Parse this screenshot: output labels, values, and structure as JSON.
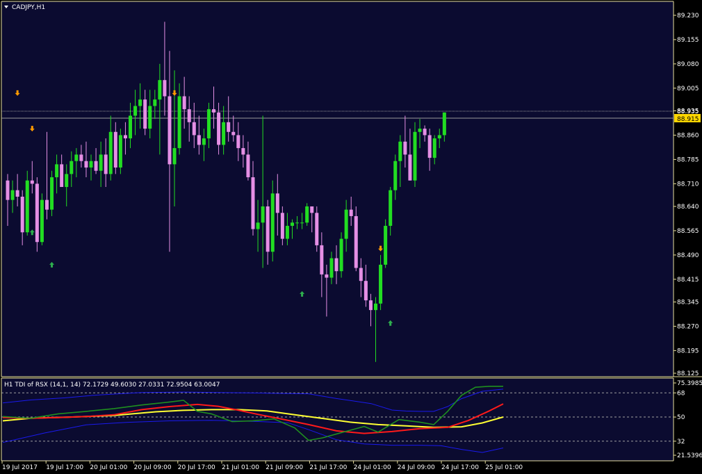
{
  "colors": {
    "background": "#000000",
    "plot_background": "#0b0b30",
    "frame": "#e8e0a0",
    "bull_candle": "#22dd22",
    "bear_candle": "#e58fe5",
    "price_label_bg": "#ffd700",
    "up_arrow": "#2eaf4e",
    "down_arrow": "#ff9a00",
    "tdi_green": "#1f8f1f",
    "tdi_red": "#ff1a1a",
    "tdi_yellow": "#ffff33",
    "tdi_blue": "#1a1aee",
    "level_line": "#a0a0a0"
  },
  "main_panel": {
    "title": "CADJPY,H1",
    "title_icon": "triangle-down-icon",
    "price_labels": [
      "89.230",
      "89.155",
      "89.080",
      "89.005",
      "88.935",
      "88.860",
      "88.785",
      "88.710",
      "88.640",
      "88.565",
      "88.490",
      "88.415",
      "88.345",
      "88.270",
      "88.195",
      "88.125"
    ],
    "current_price_label": "88.915",
    "ask_price_label": "88.935"
  },
  "indicator_panel": {
    "title": "H1 TDI of RSX  (14,1, 14) 72.1729 49.6030 27.0331 72.9504 63.0047",
    "labels": [
      "75.3985",
      "68",
      "50",
      "32",
      "21.5396"
    ],
    "levels": [
      68,
      50,
      32
    ]
  },
  "time_axis": {
    "labels": [
      "19 Jul 2017",
      "19 Jul 17:00",
      "20 Jul 01:00",
      "20 Jul 09:00",
      "20 Jul 17:00",
      "21 Jul 01:00",
      "21 Jul 09:00",
      "21 Jul 17:00",
      "24 Jul 01:00",
      "24 Jul 09:00",
      "24 Jul 17:00",
      "25 Jul 01:00"
    ]
  },
  "chart_data": {
    "type": "candlestick",
    "symbol": "CADJPY",
    "timeframe": "H1",
    "ylim": [
      88.125,
      89.23
    ],
    "candles": [
      {
        "o": 88.72,
        "h": 88.74,
        "l": 88.58,
        "c": 88.66
      },
      {
        "o": 88.66,
        "h": 88.72,
        "l": 88.62,
        "c": 88.69
      },
      {
        "o": 88.69,
        "h": 88.74,
        "l": 88.64,
        "c": 88.67
      },
      {
        "o": 88.67,
        "h": 88.69,
        "l": 88.52,
        "c": 88.56
      },
      {
        "o": 88.56,
        "h": 88.75,
        "l": 88.55,
        "c": 88.72
      },
      {
        "o": 88.72,
        "h": 88.78,
        "l": 88.68,
        "c": 88.71
      },
      {
        "o": 88.71,
        "h": 88.73,
        "l": 88.5,
        "c": 88.53
      },
      {
        "o": 88.53,
        "h": 88.68,
        "l": 88.52,
        "c": 88.66
      },
      {
        "o": 88.66,
        "h": 88.87,
        "l": 88.6,
        "c": 88.63
      },
      {
        "o": 88.63,
        "h": 88.75,
        "l": 88.61,
        "c": 88.73
      },
      {
        "o": 88.73,
        "h": 88.8,
        "l": 88.68,
        "c": 88.77
      },
      {
        "o": 88.77,
        "h": 88.8,
        "l": 88.72,
        "c": 88.7
      },
      {
        "o": 88.7,
        "h": 88.77,
        "l": 88.64,
        "c": 88.74
      },
      {
        "o": 88.74,
        "h": 88.81,
        "l": 88.7,
        "c": 88.78
      },
      {
        "o": 88.78,
        "h": 88.82,
        "l": 88.73,
        "c": 88.8
      },
      {
        "o": 88.8,
        "h": 88.83,
        "l": 88.76,
        "c": 88.78
      },
      {
        "o": 88.78,
        "h": 88.84,
        "l": 88.73,
        "c": 88.76
      },
      {
        "o": 88.76,
        "h": 88.8,
        "l": 88.72,
        "c": 88.78
      },
      {
        "o": 88.78,
        "h": 88.82,
        "l": 88.74,
        "c": 88.75
      },
      {
        "o": 88.75,
        "h": 88.84,
        "l": 88.7,
        "c": 88.8
      },
      {
        "o": 88.8,
        "h": 88.85,
        "l": 88.7,
        "c": 88.74
      },
      {
        "o": 88.74,
        "h": 88.92,
        "l": 88.72,
        "c": 88.87
      },
      {
        "o": 88.87,
        "h": 88.9,
        "l": 88.74,
        "c": 88.76
      },
      {
        "o": 88.76,
        "h": 88.88,
        "l": 88.74,
        "c": 88.86
      },
      {
        "o": 88.86,
        "h": 88.9,
        "l": 88.8,
        "c": 88.85
      },
      {
        "o": 88.85,
        "h": 88.96,
        "l": 88.82,
        "c": 88.92
      },
      {
        "o": 88.92,
        "h": 89.0,
        "l": 88.86,
        "c": 88.95
      },
      {
        "o": 88.95,
        "h": 89.02,
        "l": 88.88,
        "c": 88.97
      },
      {
        "o": 88.97,
        "h": 89.0,
        "l": 88.86,
        "c": 88.88
      },
      {
        "o": 88.88,
        "h": 89.0,
        "l": 88.85,
        "c": 88.95
      },
      {
        "o": 88.95,
        "h": 89.0,
        "l": 88.91,
        "c": 88.97
      },
      {
        "o": 88.97,
        "h": 89.08,
        "l": 88.8,
        "c": 89.03
      },
      {
        "o": 89.03,
        "h": 89.21,
        "l": 88.92,
        "c": 88.98
      },
      {
        "o": 88.98,
        "h": 89.12,
        "l": 88.5,
        "c": 88.77
      },
      {
        "o": 88.77,
        "h": 89.06,
        "l": 88.64,
        "c": 88.82
      },
      {
        "o": 88.82,
        "h": 89.02,
        "l": 88.8,
        "c": 88.98
      },
      {
        "o": 88.98,
        "h": 89.04,
        "l": 88.88,
        "c": 88.94
      },
      {
        "o": 88.94,
        "h": 88.98,
        "l": 88.84,
        "c": 88.9
      },
      {
        "o": 88.9,
        "h": 88.96,
        "l": 88.82,
        "c": 88.86
      },
      {
        "o": 88.86,
        "h": 88.92,
        "l": 88.8,
        "c": 88.83
      },
      {
        "o": 88.83,
        "h": 88.88,
        "l": 88.78,
        "c": 88.85
      },
      {
        "o": 88.85,
        "h": 88.96,
        "l": 88.82,
        "c": 88.94
      },
      {
        "o": 88.94,
        "h": 89.01,
        "l": 88.88,
        "c": 88.93
      },
      {
        "o": 88.93,
        "h": 88.96,
        "l": 88.8,
        "c": 88.83
      },
      {
        "o": 88.83,
        "h": 88.95,
        "l": 88.8,
        "c": 88.9
      },
      {
        "o": 88.9,
        "h": 88.98,
        "l": 88.84,
        "c": 88.87
      },
      {
        "o": 88.87,
        "h": 88.92,
        "l": 88.84,
        "c": 88.86
      },
      {
        "o": 88.86,
        "h": 88.9,
        "l": 88.78,
        "c": 88.82
      },
      {
        "o": 88.82,
        "h": 88.86,
        "l": 88.76,
        "c": 88.8
      },
      {
        "o": 88.8,
        "h": 88.84,
        "l": 88.72,
        "c": 88.73
      },
      {
        "o": 88.73,
        "h": 88.78,
        "l": 88.55,
        "c": 88.57
      },
      {
        "o": 88.57,
        "h": 88.66,
        "l": 88.5,
        "c": 88.59
      },
      {
        "o": 88.59,
        "h": 88.92,
        "l": 88.45,
        "c": 88.64
      },
      {
        "o": 88.64,
        "h": 88.66,
        "l": 88.46,
        "c": 88.5
      },
      {
        "o": 88.5,
        "h": 88.72,
        "l": 88.47,
        "c": 88.68
      },
      {
        "o": 88.68,
        "h": 88.74,
        "l": 88.55,
        "c": 88.62
      },
      {
        "o": 88.62,
        "h": 88.64,
        "l": 88.52,
        "c": 88.54
      },
      {
        "o": 88.54,
        "h": 88.62,
        "l": 88.52,
        "c": 88.58
      },
      {
        "o": 88.58,
        "h": 88.6,
        "l": 88.54,
        "c": 88.59
      },
      {
        "o": 88.59,
        "h": 88.61,
        "l": 88.57,
        "c": 88.59
      },
      {
        "o": 88.59,
        "h": 88.62,
        "l": 88.57,
        "c": 88.59
      },
      {
        "o": 88.59,
        "h": 88.65,
        "l": 88.58,
        "c": 88.64
      },
      {
        "o": 88.64,
        "h": 88.64,
        "l": 88.56,
        "c": 88.62
      },
      {
        "o": 88.62,
        "h": 88.64,
        "l": 88.5,
        "c": 88.52
      },
      {
        "o": 88.52,
        "h": 88.56,
        "l": 88.36,
        "c": 88.43
      },
      {
        "o": 88.43,
        "h": 88.46,
        "l": 88.3,
        "c": 88.42
      },
      {
        "o": 88.42,
        "h": 88.5,
        "l": 88.4,
        "c": 88.48
      },
      {
        "o": 88.48,
        "h": 88.52,
        "l": 88.4,
        "c": 88.44
      },
      {
        "o": 88.44,
        "h": 88.56,
        "l": 88.42,
        "c": 88.54
      },
      {
        "o": 88.54,
        "h": 88.66,
        "l": 88.5,
        "c": 88.63
      },
      {
        "o": 88.63,
        "h": 88.67,
        "l": 88.58,
        "c": 88.61
      },
      {
        "o": 88.61,
        "h": 88.64,
        "l": 88.44,
        "c": 88.45
      },
      {
        "o": 88.45,
        "h": 88.48,
        "l": 88.36,
        "c": 88.41
      },
      {
        "o": 88.41,
        "h": 88.46,
        "l": 88.33,
        "c": 88.35
      },
      {
        "o": 88.35,
        "h": 88.37,
        "l": 88.27,
        "c": 88.32
      },
      {
        "o": 88.32,
        "h": 88.36,
        "l": 88.16,
        "c": 88.34
      },
      {
        "o": 88.34,
        "h": 88.49,
        "l": 88.32,
        "c": 88.46
      },
      {
        "o": 88.46,
        "h": 88.6,
        "l": 88.45,
        "c": 88.58
      },
      {
        "o": 88.58,
        "h": 88.7,
        "l": 88.55,
        "c": 88.69
      },
      {
        "o": 88.69,
        "h": 88.8,
        "l": 88.66,
        "c": 88.78
      },
      {
        "o": 88.78,
        "h": 88.86,
        "l": 88.7,
        "c": 88.84
      },
      {
        "o": 88.84,
        "h": 88.92,
        "l": 88.76,
        "c": 88.8
      },
      {
        "o": 88.8,
        "h": 88.88,
        "l": 88.72,
        "c": 88.72
      },
      {
        "o": 88.72,
        "h": 88.9,
        "l": 88.7,
        "c": 88.87
      },
      {
        "o": 88.87,
        "h": 88.91,
        "l": 88.82,
        "c": 88.88
      },
      {
        "o": 88.88,
        "h": 88.89,
        "l": 88.84,
        "c": 88.86
      },
      {
        "o": 88.86,
        "h": 88.88,
        "l": 88.75,
        "c": 88.79
      },
      {
        "o": 88.79,
        "h": 88.86,
        "l": 88.77,
        "c": 88.85
      },
      {
        "o": 88.85,
        "h": 88.88,
        "l": 88.82,
        "c": 88.86
      },
      {
        "o": 88.86,
        "h": 88.93,
        "l": 88.84,
        "c": 88.93
      }
    ],
    "up_arrows": [
      {
        "i": 5,
        "price": 88.56
      },
      {
        "i": 9,
        "price": 88.46
      },
      {
        "i": 60,
        "price": 88.37
      },
      {
        "i": 78,
        "price": 88.28
      }
    ],
    "down_arrows": [
      {
        "i": 2,
        "price": 88.99
      },
      {
        "i": 5,
        "price": 88.88
      },
      {
        "i": 34,
        "price": 88.99
      },
      {
        "i": 76,
        "price": 88.51
      }
    ],
    "indicator": {
      "name": "TDI of RSX",
      "ylim": [
        21.5396,
        75.3985
      ],
      "levels": [
        68,
        50,
        32
      ],
      "series": [
        {
          "color": "tdi_blue",
          "values": [
            [
              0,
              60.5
            ],
            [
              40,
              62.7
            ],
            [
              90,
              64.3
            ],
            [
              130,
              66.2
            ],
            [
              200,
              68.3
            ],
            [
              260,
              68.6
            ],
            [
              320,
              68.2
            ],
            [
              380,
              67.8
            ],
            [
              440,
              67.3
            ],
            [
              480,
              63.8
            ],
            [
              530,
              60.0
            ],
            [
              560,
              55.2
            ],
            [
              580,
              54.5
            ],
            [
              600,
              54.2
            ],
            [
              620,
              54.2
            ],
            [
              640,
              57.8
            ],
            [
              660,
              63.7
            ],
            [
              690,
              69.2
            ],
            [
              720,
              70.8
            ]
          ]
        },
        {
          "color": "tdi_blue",
          "values": [
            [
              0,
              31.0
            ],
            [
              60,
              38.1
            ],
            [
              120,
              44.2
            ],
            [
              180,
              46.1
            ],
            [
              240,
              47.2
            ],
            [
              300,
              47.6
            ],
            [
              360,
              46.8
            ],
            [
              410,
              45.8
            ],
            [
              440,
              40.6
            ],
            [
              480,
              33.1
            ],
            [
              520,
              30.0
            ],
            [
              560,
              29.0
            ],
            [
              600,
              29.0
            ],
            [
              630,
              28.7
            ],
            [
              660,
              25.9
            ],
            [
              690,
              23.6
            ],
            [
              720,
              27.0
            ]
          ]
        },
        {
          "color": "tdi_yellow",
          "values": [
            [
              0,
              47.2
            ],
            [
              40,
              49.1
            ],
            [
              100,
              50.0
            ],
            [
              160,
              51.2
            ],
            [
              220,
              53.9
            ],
            [
              260,
              55.0
            ],
            [
              300,
              55.5
            ],
            [
              340,
              55.5
            ],
            [
              380,
              54.6
            ],
            [
              420,
              51.7
            ],
            [
              460,
              49.0
            ],
            [
              500,
              46.2
            ],
            [
              540,
              44.4
            ],
            [
              580,
              43.4
            ],
            [
              620,
              42.3
            ],
            [
              660,
              42.7
            ],
            [
              690,
              45.6
            ],
            [
              720,
              50.0
            ]
          ]
        },
        {
          "color": "tdi_red",
          "values": [
            [
              0,
              49.6
            ],
            [
              40,
              49.1
            ],
            [
              80,
              49.6
            ],
            [
              120,
              50.4
            ],
            [
              160,
              51.7
            ],
            [
              200,
              55.5
            ],
            [
              240,
              57.8
            ],
            [
              280,
              59.4
            ],
            [
              310,
              58.0
            ],
            [
              340,
              55.0
            ],
            [
              370,
              51.7
            ],
            [
              400,
              48.6
            ],
            [
              440,
              44.4
            ],
            [
              480,
              39.7
            ],
            [
              520,
              37.8
            ],
            [
              560,
              39.2
            ],
            [
              600,
              41.4
            ],
            [
              640,
              42.3
            ],
            [
              670,
              47.5
            ],
            [
              700,
              54.6
            ],
            [
              720,
              59.8
            ]
          ]
        },
        {
          "color": "tdi_green",
          "values": [
            [
              0,
              50.4
            ],
            [
              40,
              49.1
            ],
            [
              80,
              52.4
            ],
            [
              120,
              54.2
            ],
            [
              160,
              56.3
            ],
            [
              200,
              59.0
            ],
            [
              240,
              61.2
            ],
            [
              260,
              62.5
            ],
            [
              280,
              54.2
            ],
            [
              300,
              52.4
            ],
            [
              330,
              46.6
            ],
            [
              360,
              47.2
            ],
            [
              390,
              48.6
            ],
            [
              420,
              41.9
            ],
            [
              440,
              32.6
            ],
            [
              460,
              34.5
            ],
            [
              490,
              38.8
            ],
            [
              520,
              43.0
            ],
            [
              540,
              38.8
            ],
            [
              570,
              48.1
            ],
            [
              600,
              46.2
            ],
            [
              620,
              44.4
            ],
            [
              640,
              54.2
            ],
            [
              660,
              66.2
            ],
            [
              680,
              72.2
            ],
            [
              700,
              72.9
            ],
            [
              720,
              72.9
            ]
          ]
        }
      ]
    }
  }
}
